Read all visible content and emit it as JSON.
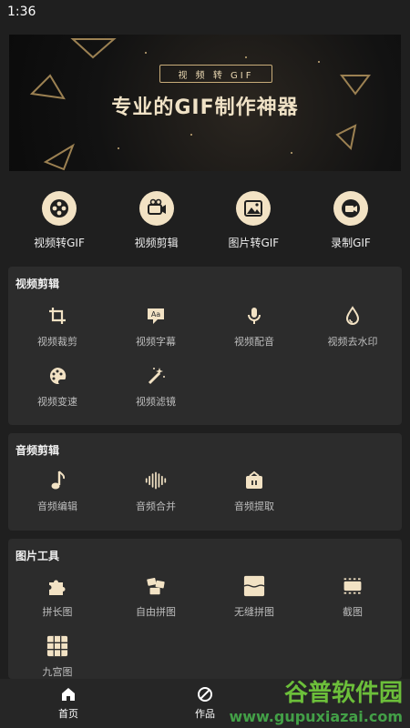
{
  "status_bar": {
    "time": "1:36"
  },
  "banner": {
    "chip": "视 频 转 GIF",
    "headline": "专业的GIF制作神器"
  },
  "quick_actions": [
    {
      "label": "视频转GIF",
      "icon": "film-reel-icon"
    },
    {
      "label": "视频剪辑",
      "icon": "video-clip-icon"
    },
    {
      "label": "图片转GIF",
      "icon": "image-icon"
    },
    {
      "label": "录制GIF",
      "icon": "record-icon"
    }
  ],
  "sections": {
    "video_edit": {
      "title": "视频剪辑",
      "items": [
        {
          "label": "视频裁剪",
          "icon": "crop-icon"
        },
        {
          "label": "视频字幕",
          "icon": "subtitle-icon"
        },
        {
          "label": "视频配音",
          "icon": "microphone-icon"
        },
        {
          "label": "视频去水印",
          "icon": "drop-icon"
        },
        {
          "label": "视频变速",
          "icon": "palette-icon"
        },
        {
          "label": "视频滤镜",
          "icon": "magic-wand-icon"
        }
      ]
    },
    "audio_edit": {
      "title": "音频剪辑",
      "items": [
        {
          "label": "音频编辑",
          "icon": "music-note-icon"
        },
        {
          "label": "音频合并",
          "icon": "waveform-icon"
        },
        {
          "label": "音频提取",
          "icon": "audio-extract-icon"
        }
      ]
    },
    "image_tools": {
      "title": "图片工具",
      "items": [
        {
          "label": "拼长图",
          "icon": "puzzle-icon"
        },
        {
          "label": "自由拼图",
          "icon": "free-collage-icon"
        },
        {
          "label": "无缝拼图",
          "icon": "seamless-collage-icon"
        },
        {
          "label": "截图",
          "icon": "screenshot-icon"
        },
        {
          "label": "九宫图",
          "icon": "nine-grid-icon"
        }
      ]
    }
  },
  "bottom_nav": {
    "home": "首页",
    "works": "作品"
  },
  "watermark": {
    "big": "谷普软件园",
    "url": "www.gupuxiazai.com"
  },
  "colors": {
    "accent": "#f2e2c4",
    "background": "#1f1f1f",
    "card": "#2c2c2c"
  }
}
